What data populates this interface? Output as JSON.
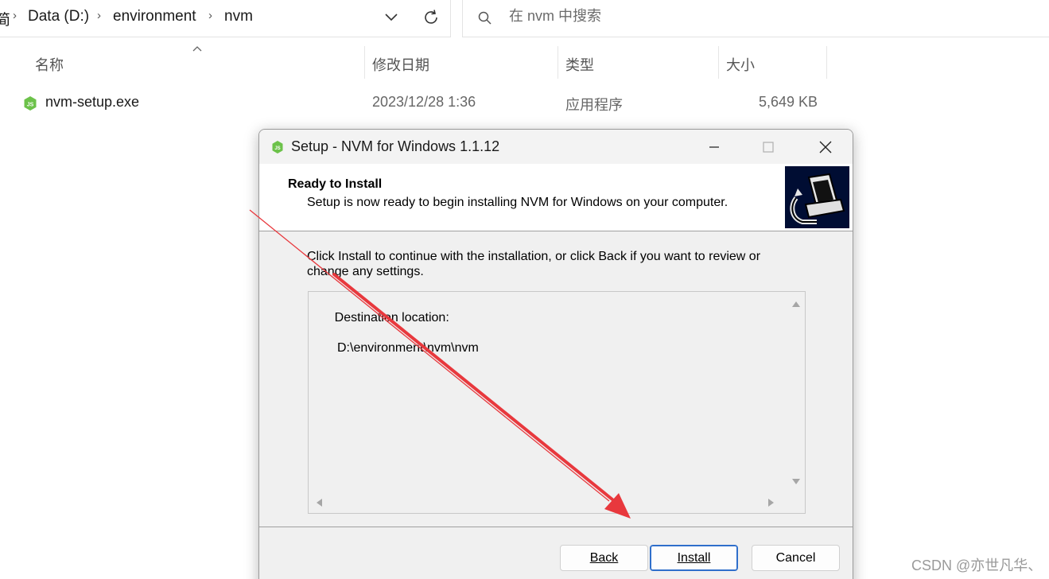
{
  "explorer": {
    "breadcrumb_partial": "简",
    "breadcrumb": [
      "Data (D:)",
      "environment",
      "nvm"
    ],
    "search_placeholder": "在 nvm 中搜索",
    "columns": {
      "name": "名称",
      "modified": "修改日期",
      "type": "类型",
      "size": "大小"
    },
    "files": [
      {
        "name": "nvm-setup.exe",
        "modified": "2023/12/28 1:36",
        "type": "应用程序",
        "size": "5,649 KB"
      }
    ]
  },
  "dialog": {
    "title": "Setup - NVM for Windows 1.1.12",
    "header_title": "Ready to Install",
    "header_subtitle": "Setup is now ready to begin installing NVM for Windows on your computer.",
    "body_line1": "Click Install to continue with the installation, or click Back if you want to review or",
    "body_line2": "change any settings.",
    "memo_label": "Destination location:",
    "memo_path": "D:\\environment\\nvm\\nvm",
    "buttons": {
      "back": "Back",
      "install": "Install",
      "cancel": "Cancel"
    }
  },
  "watermark": "CSDN @亦世凡华、",
  "colors": {
    "annotation_arrow": "#e8383d",
    "default_button_border": "#2f6fcb",
    "node_green": "#6cc24a"
  }
}
